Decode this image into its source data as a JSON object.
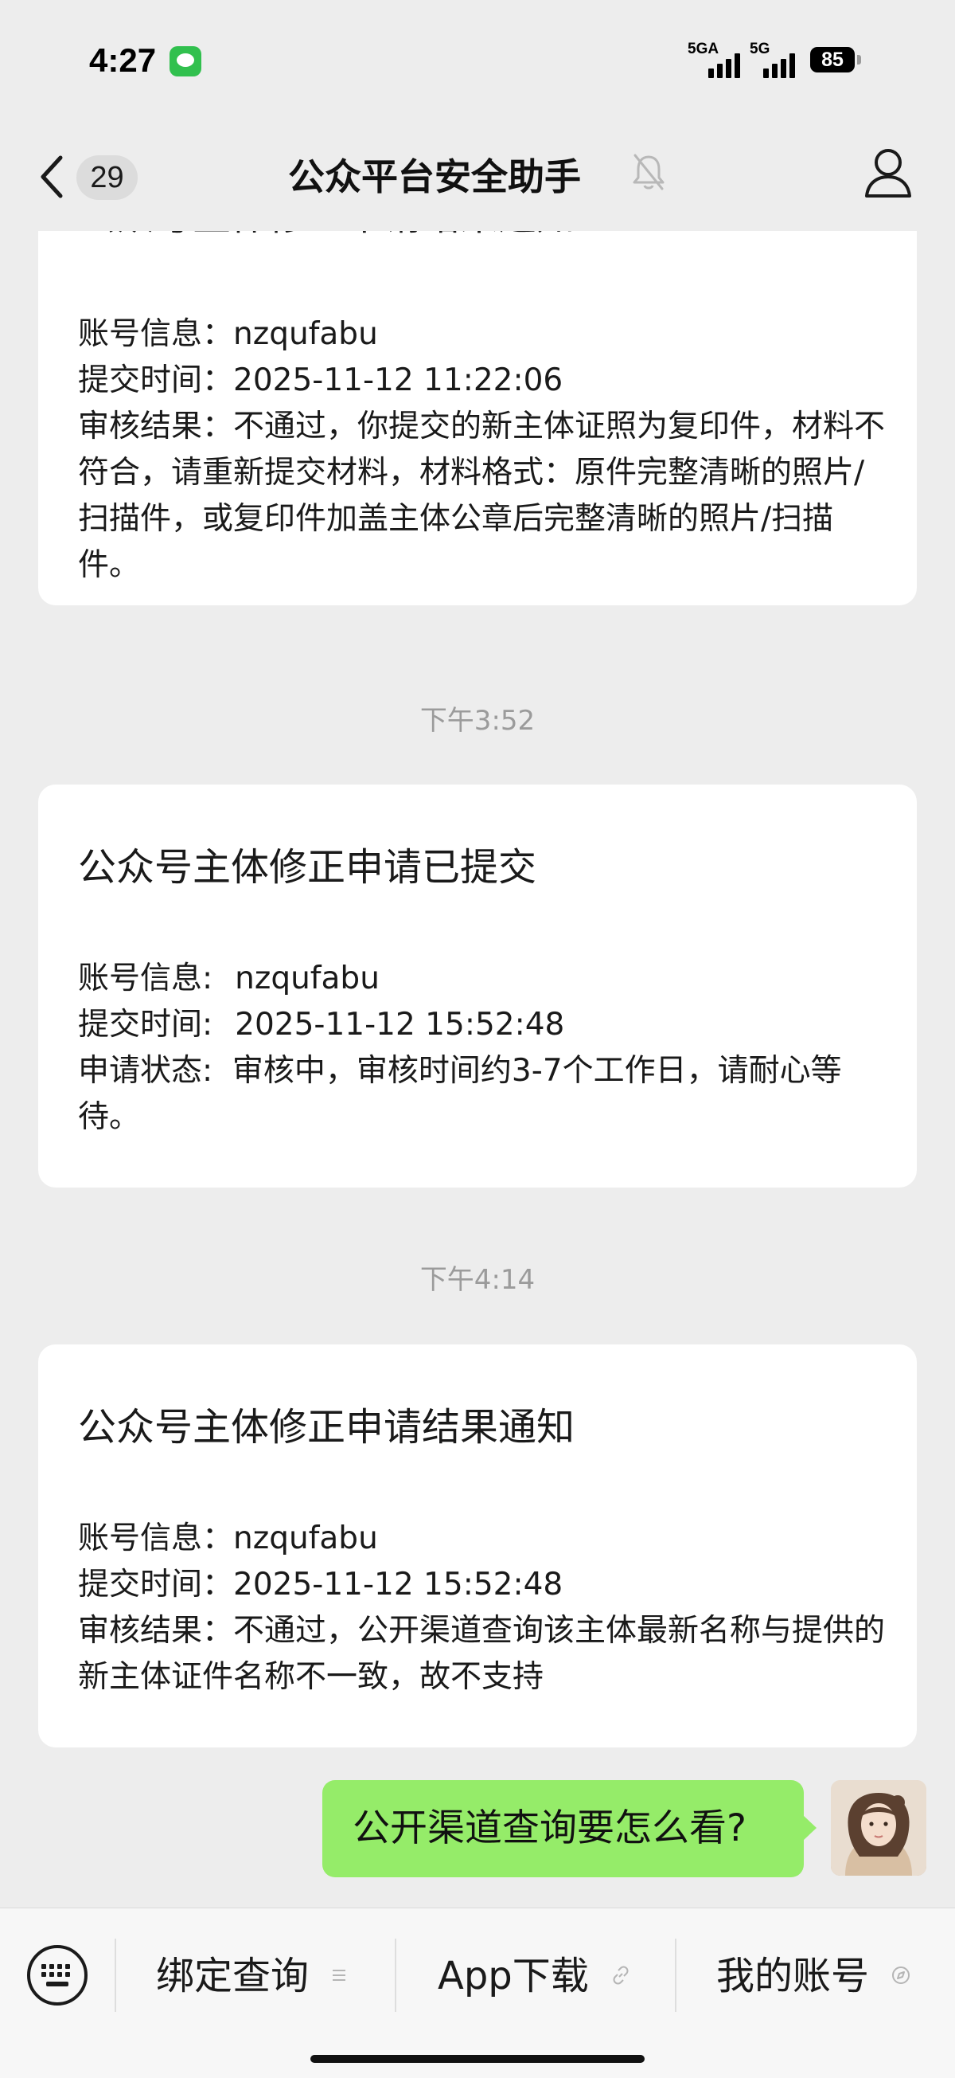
{
  "status_bar": {
    "time": "4:27",
    "network_1": "5GA",
    "network_2": "5G",
    "battery": "85"
  },
  "nav": {
    "unread_count": "29",
    "title": "公众平台安全助手",
    "mute_icon": "bell-off-icon",
    "profile_icon": "person-icon"
  },
  "messages": [
    {
      "title": "公众号主体修正申请结果通知",
      "account_label": "账号信息：",
      "account_value": "nzqufabu",
      "time_label": "提交时间：",
      "time_value": "2025-11-12 11:22:06",
      "result_text": "审核结果：不通过，你提交的新主体证照为复印件，材料不符合，请重新提交材料，材料格式：原件完整清晰的照片/扫描件，或复印件加盖主体公章后完整清晰的照片/扫描件。"
    },
    {
      "timestamp": "下午3:52",
      "title": "公众号主体修正申请已提交",
      "account_label": "账号信息:",
      "account_value": "nzqufabu",
      "time_label": "提交时间:",
      "time_value": "2025-11-12 15:52:48",
      "status_text": "申请状态:  审核中，审核时间约3-7个工作日，请耐心等待。"
    },
    {
      "timestamp": "下午4:14",
      "title": "公众号主体修正申请结果通知",
      "account_label": "账号信息：",
      "account_value": "nzqufabu",
      "time_label": "提交时间：",
      "time_value": "2025-11-12 15:52:48",
      "result_text": "审核结果：不通过，公开渠道查询该主体最新名称与提供的新主体证件名称不一致，故不支持"
    }
  ],
  "my_message": "公开渠道查询要怎么看?",
  "menu": {
    "keyboard_icon": "keyboard-icon",
    "items": [
      {
        "label": "绑定查询",
        "icon": "list-icon"
      },
      {
        "label": "App下载",
        "icon": "link-icon"
      },
      {
        "label": "我的账号",
        "icon": "compass-icon"
      }
    ]
  },
  "colors": {
    "background": "#ededed",
    "my_bubble": "#95ec69",
    "card": "#ffffff",
    "timestamp": "#9b9b9b"
  }
}
